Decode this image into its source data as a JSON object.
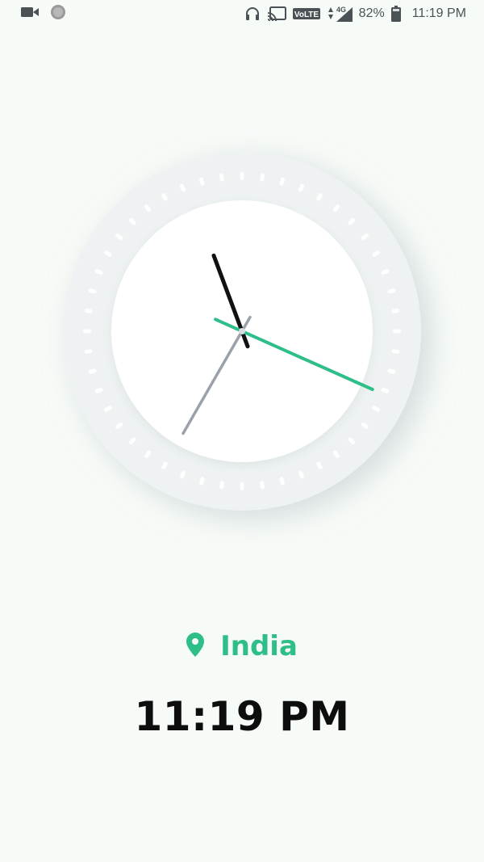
{
  "status_bar": {
    "battery_percent": "82%",
    "network_label": "4G",
    "volte_label": "VoLTE",
    "time": "11:19 PM",
    "icons": [
      "video-camera-icon",
      "circle-notification-icon",
      "headphones-icon",
      "cast-icon",
      "volte-icon",
      "signal-icon",
      "battery-icon"
    ]
  },
  "clock": {
    "hour": 11,
    "minute": 19,
    "second": 35,
    "tick_count": 48,
    "colors": {
      "bezel": "#eef2f2",
      "face": "#ffffff",
      "tick": "#ffffff",
      "hour_hand": "#111111",
      "minute_hand": "#2ebf89",
      "second_hand": "#9aa1aa"
    }
  },
  "location": {
    "icon": "location-pin-icon",
    "name": "India",
    "accent_color": "#2ebf89"
  },
  "digital_time": "11:19 PM"
}
